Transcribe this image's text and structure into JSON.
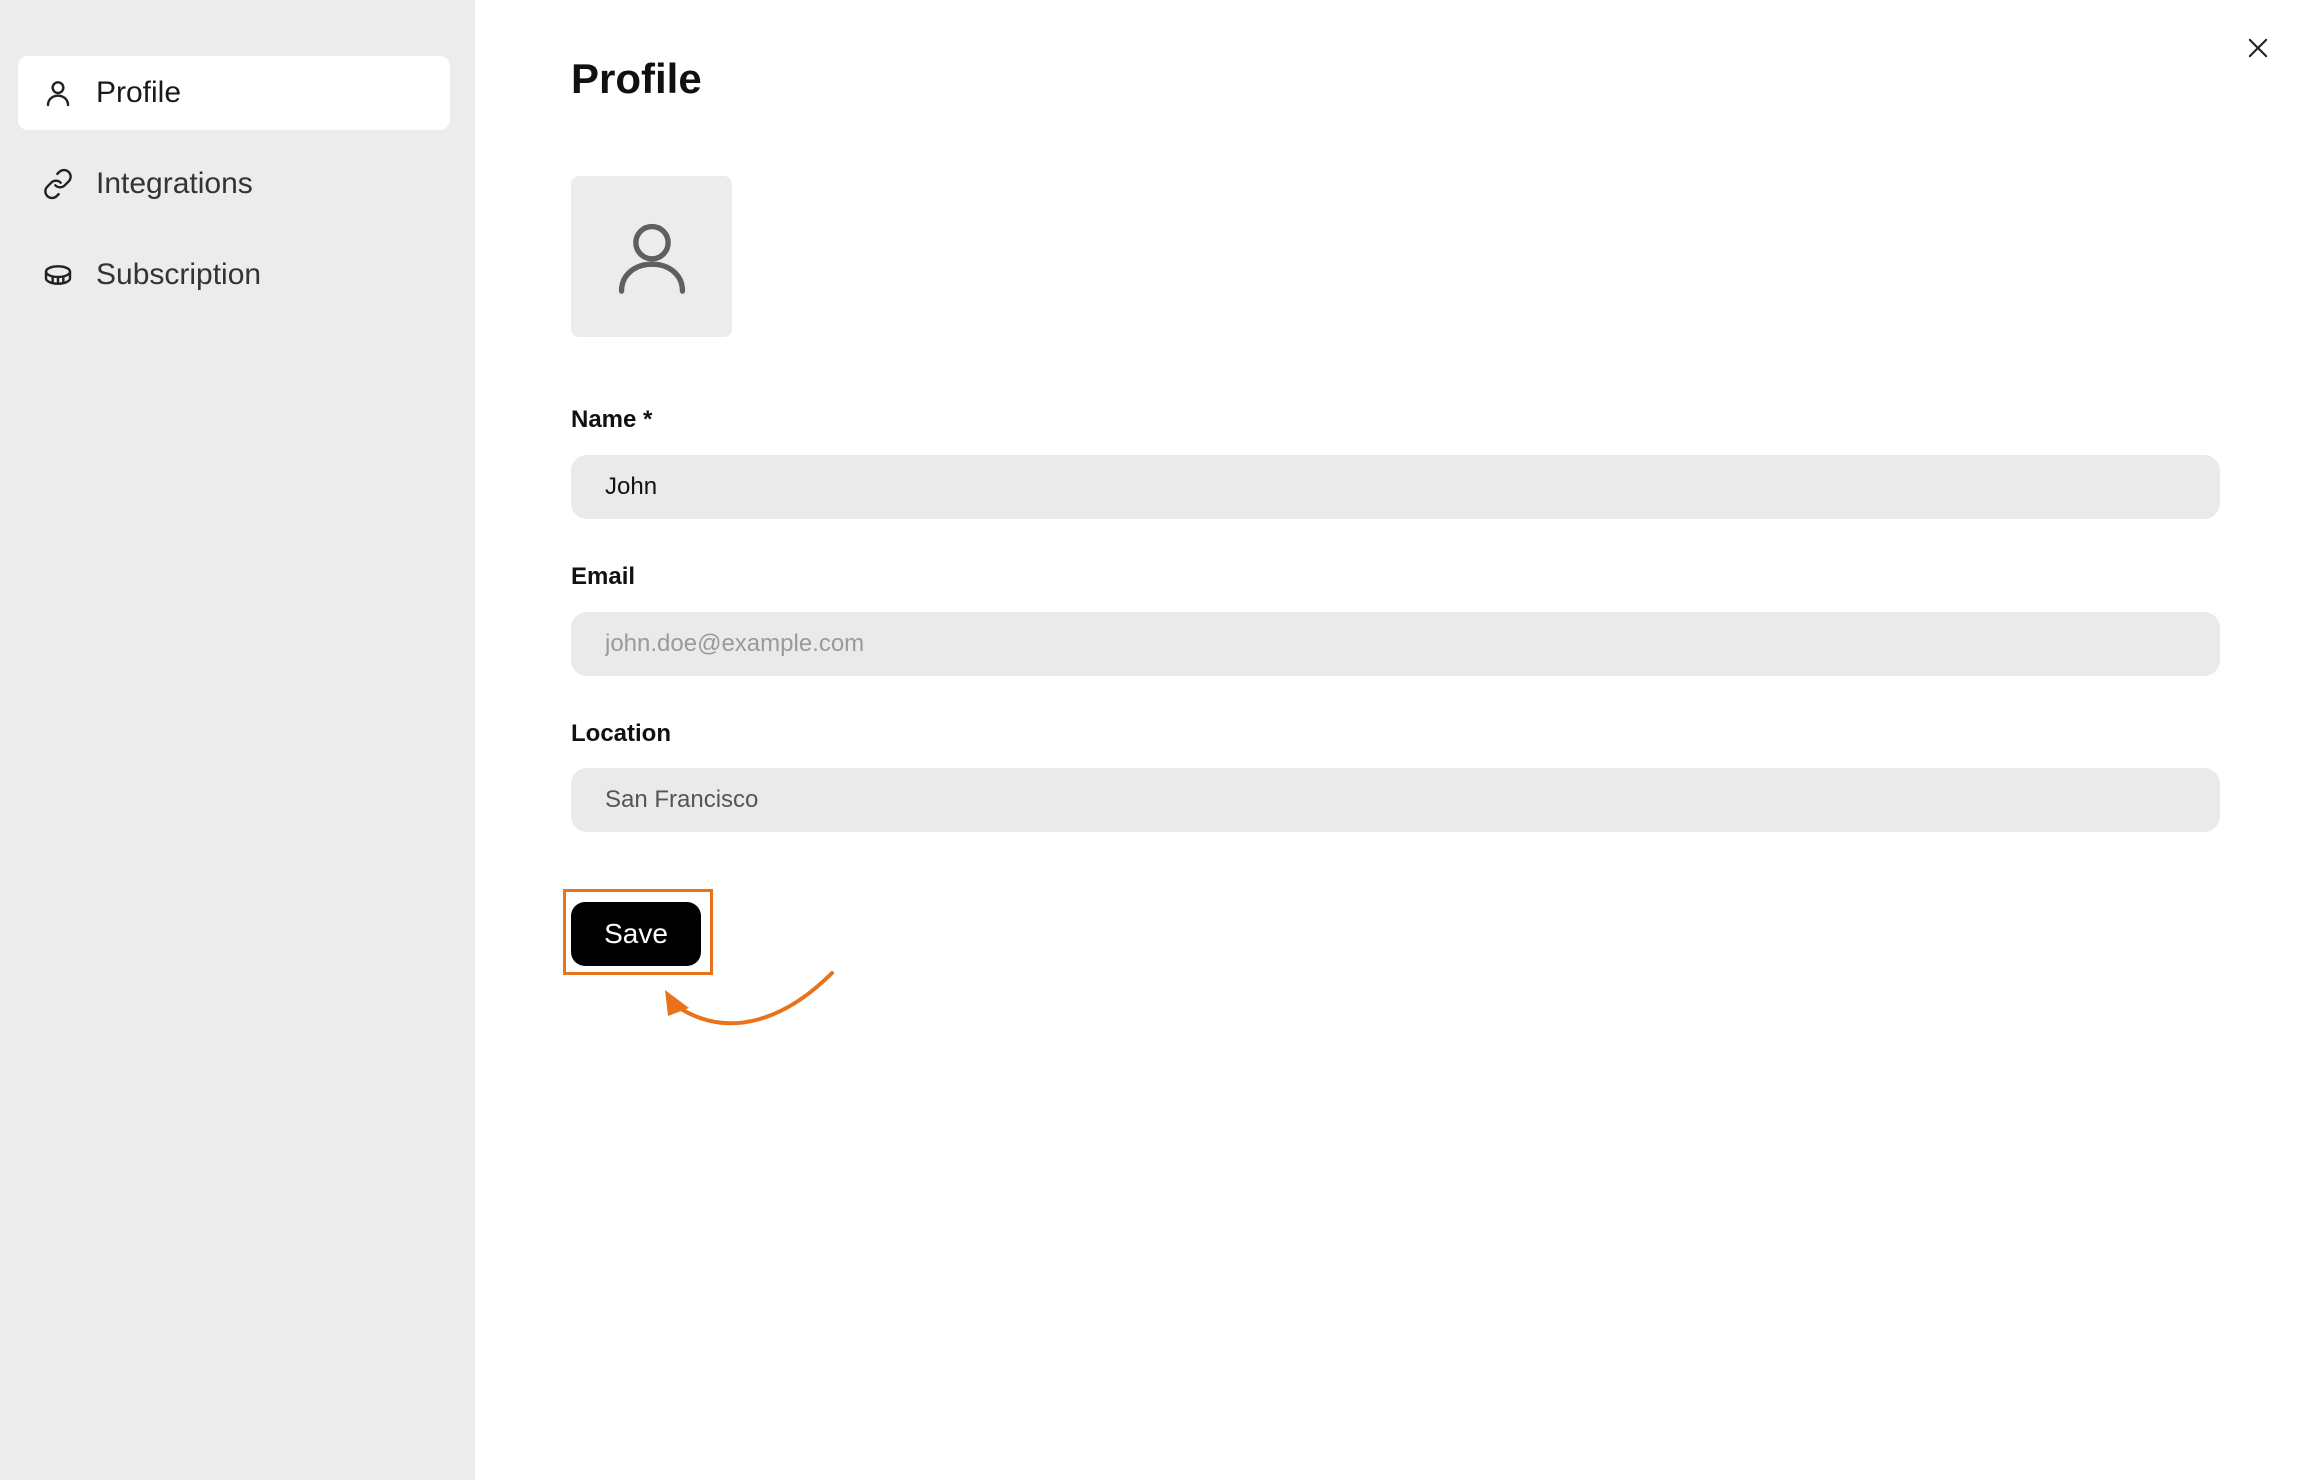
{
  "sidebar": {
    "items": [
      {
        "label": "Profile",
        "icon": "user-icon",
        "active": true
      },
      {
        "label": "Integrations",
        "icon": "link-icon",
        "active": false
      },
      {
        "label": "Subscription",
        "icon": "coin-icon",
        "active": false
      }
    ]
  },
  "main": {
    "title": "Profile",
    "avatar_icon": "user-placeholder-icon",
    "fields": {
      "name": {
        "label": "Name *",
        "value": "John",
        "placeholder": ""
      },
      "email": {
        "label": "Email",
        "value": "",
        "placeholder": "john.doe@example.com"
      },
      "location": {
        "label": "Location",
        "value": "San Francisco",
        "placeholder": ""
      }
    },
    "save_label": "Save"
  },
  "colors": {
    "sidebar_bg": "#ececec",
    "input_bg": "#eaeaea",
    "primary_button": "#000000",
    "annotation": "#e8731a"
  }
}
